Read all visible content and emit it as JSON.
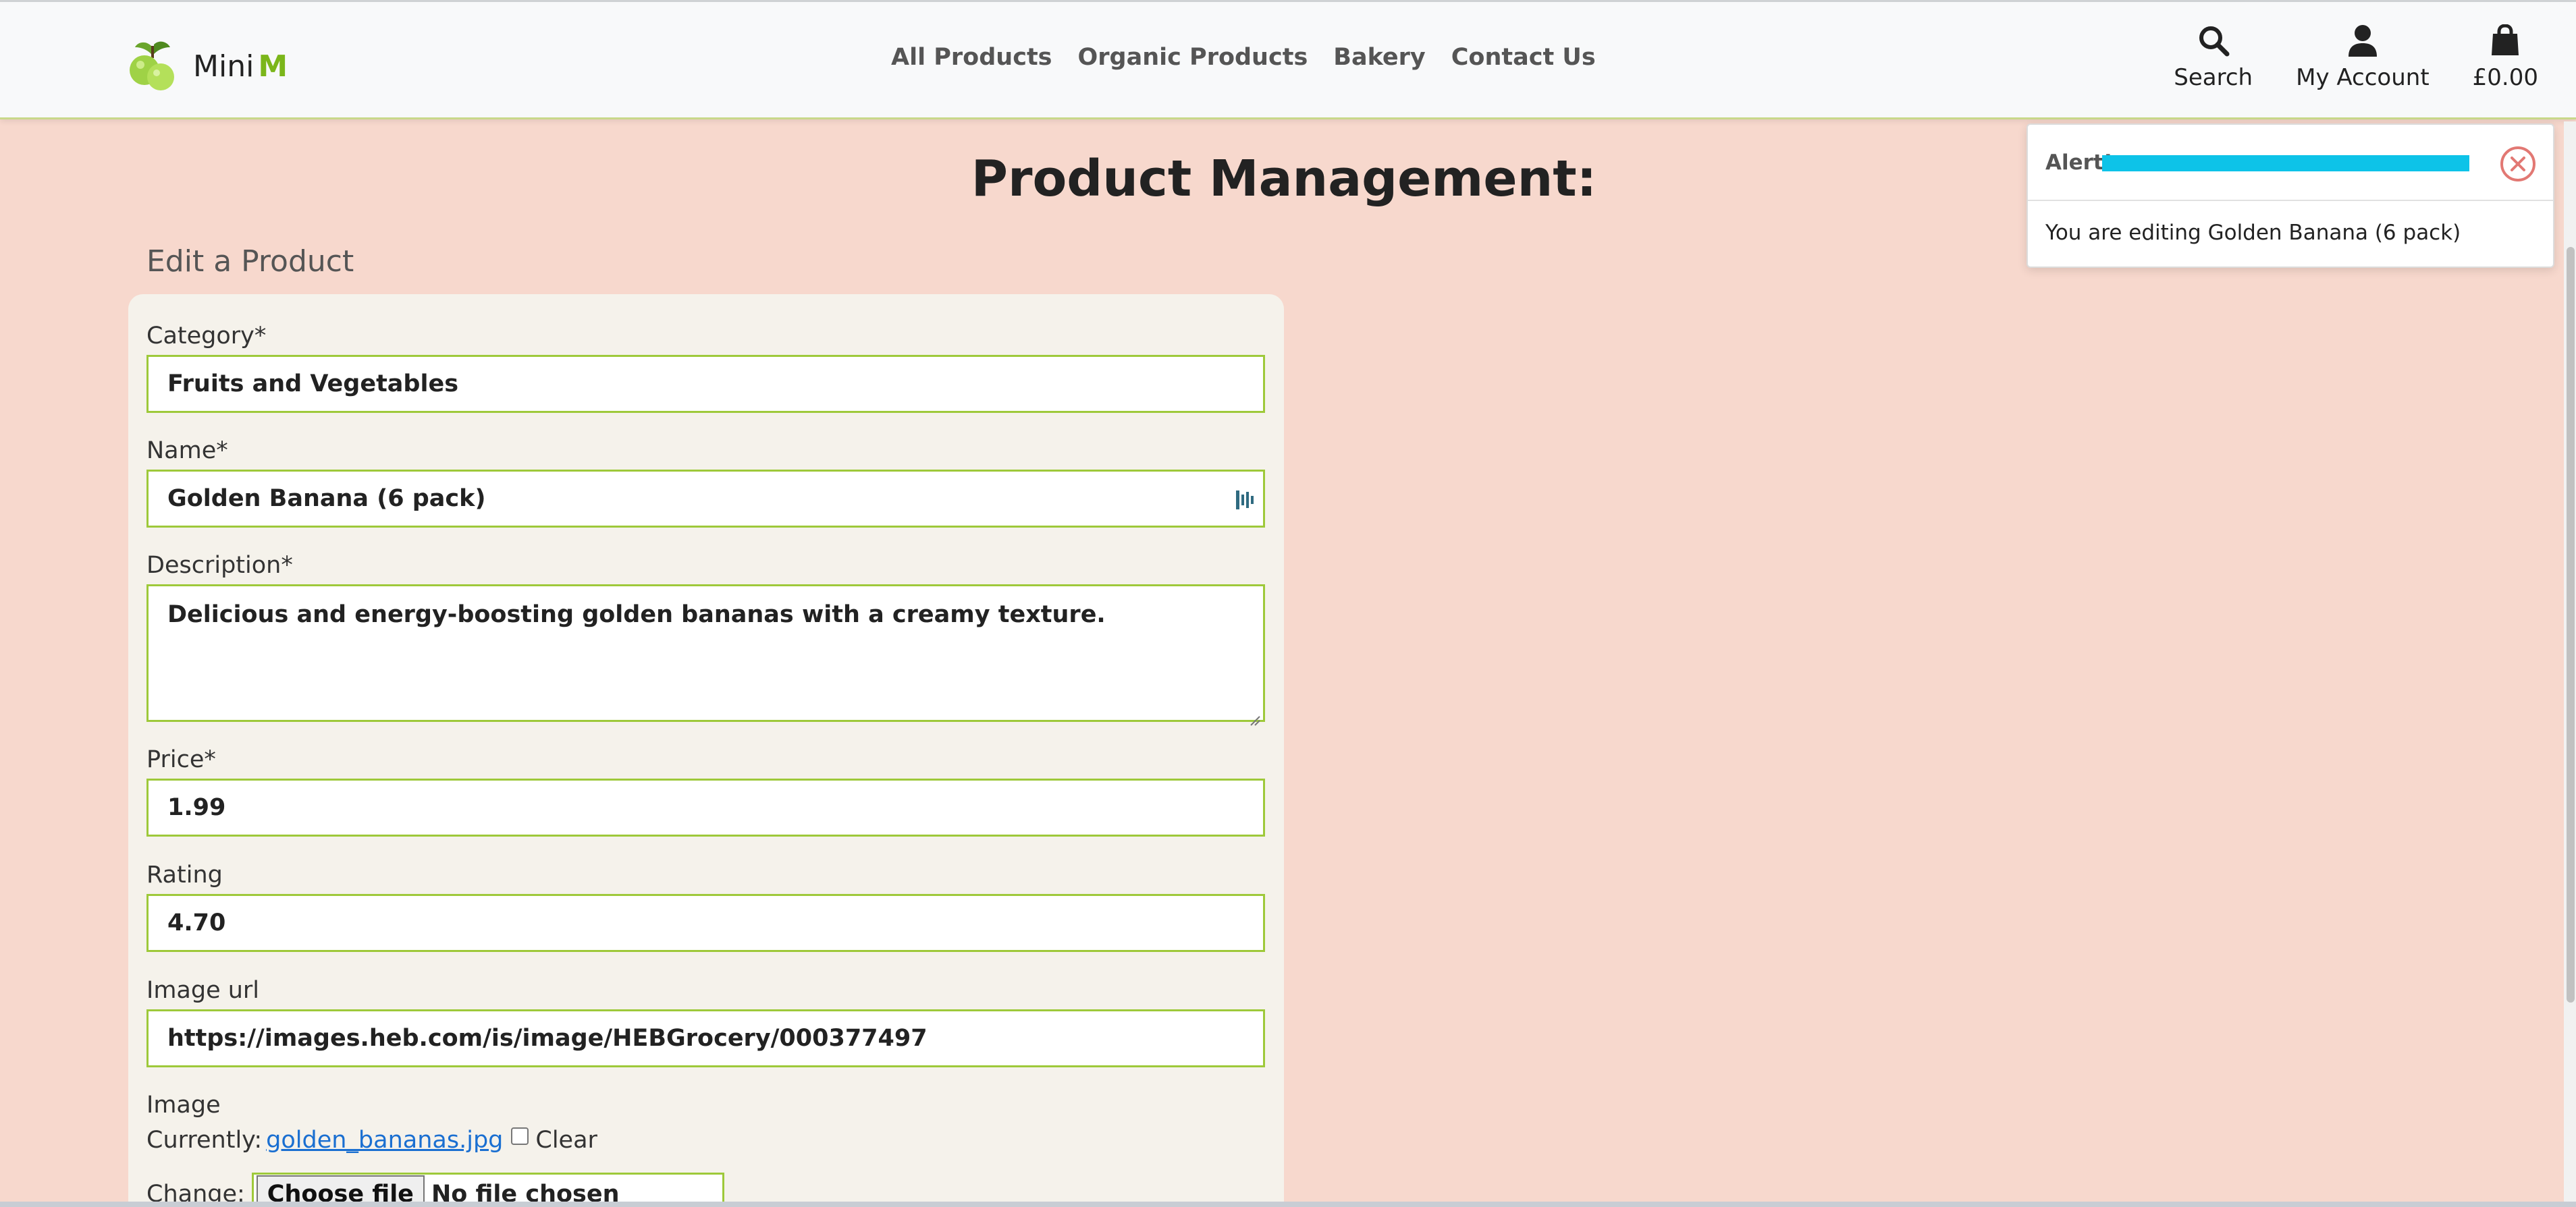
{
  "brand": {
    "name": "Mini",
    "accent": "M",
    "accent_color": "#7bb61a"
  },
  "nav": {
    "links": [
      "All Products",
      "Organic Products",
      "Bakery",
      "Contact Us"
    ],
    "actions": {
      "search": "Search",
      "account": "My Account",
      "cart": "£0.00"
    }
  },
  "page": {
    "title": "Product Management:",
    "section": "Edit a Product"
  },
  "form": {
    "category": {
      "label": "Category*",
      "value": "Fruits and Vegetables"
    },
    "name": {
      "label": "Name*",
      "value": "Golden Banana (6 pack)"
    },
    "description": {
      "label": "Description*",
      "value": "Delicious and energy-boosting golden bananas with a creamy texture."
    },
    "price": {
      "label": "Price*",
      "value": "1.99"
    },
    "rating": {
      "label": "Rating",
      "value": "4.70"
    },
    "image_url": {
      "label": "Image url",
      "value": "https://images.heb.com/is/image/HEBGrocery/000377497"
    },
    "image": {
      "label": "Image",
      "currently_label": "Currently:",
      "current_file": "golden_bananas.jpg",
      "clear_label": "Clear",
      "change_label": "Change:",
      "choose_button": "Choose file",
      "no_file": "No file chosen"
    }
  },
  "toast": {
    "title": "Alert!",
    "message": "You are editing Golden Banana (6 pack)",
    "progress_color": "#0dc3e8",
    "progress": 1.0
  },
  "colors": {
    "page_bg": "#f7d8cd",
    "input_border": "#9ec93a",
    "link": "#1a6fd1"
  }
}
